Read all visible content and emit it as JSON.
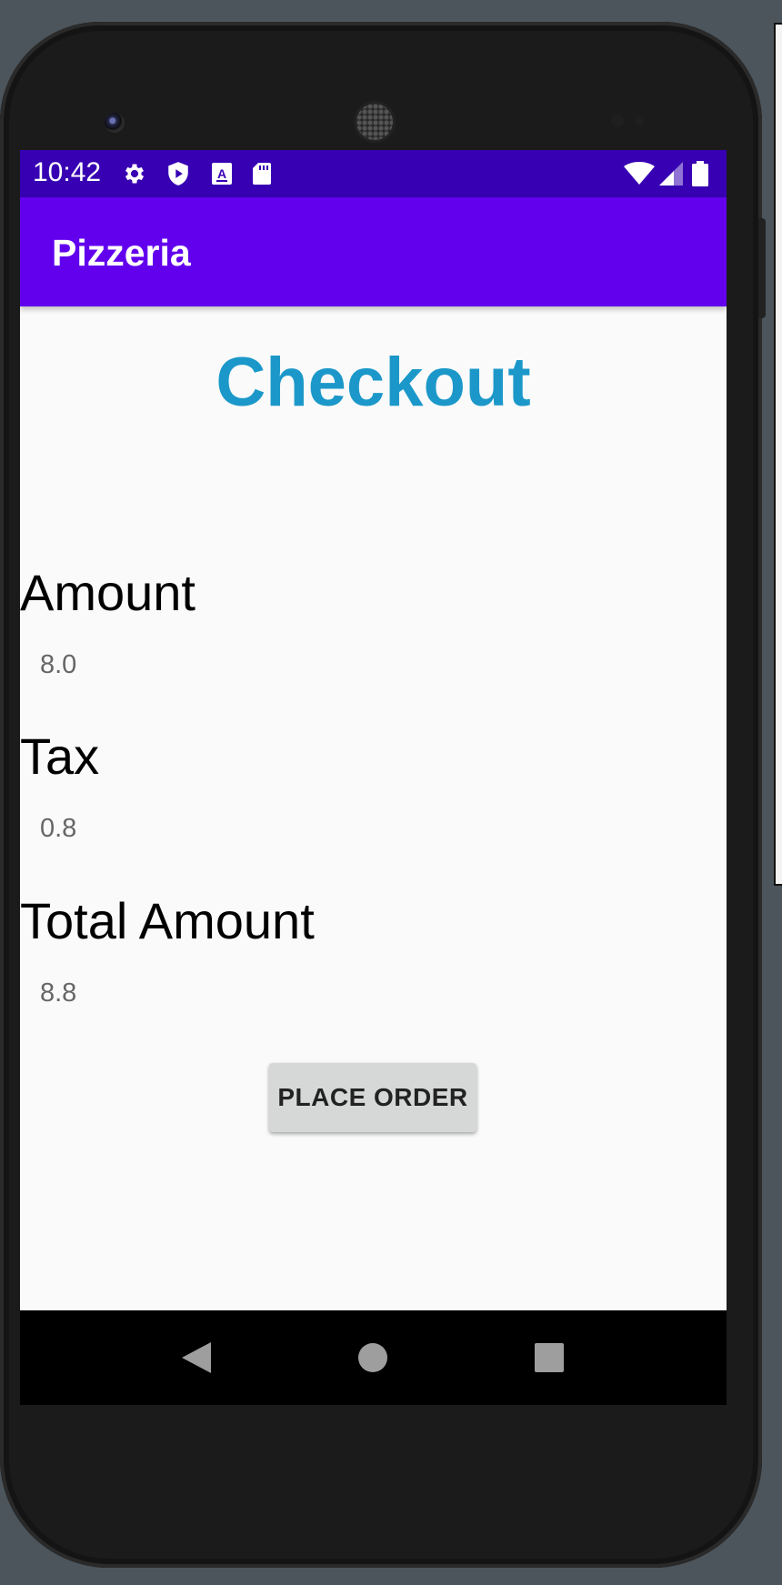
{
  "status_bar": {
    "time": "10:42",
    "left_icons": [
      "gear-icon",
      "shield-play-icon",
      "a-text-icon",
      "sd-card-icon"
    ],
    "right_icons": [
      "wifi-icon",
      "cellular-signal-icon",
      "battery-icon"
    ],
    "color": "#3700b3"
  },
  "app_bar": {
    "title": "Pizzeria",
    "color": "#6200ee"
  },
  "checkout": {
    "title": "Checkout",
    "title_color": "#1b98c9",
    "amount_label": "Amount",
    "amount_value": "8.0",
    "tax_label": "Tax",
    "tax_value": "0.8",
    "total_label": "Total Amount",
    "total_value": "8.8",
    "place_order_label": "PLACE ORDER"
  },
  "nav_bar": {
    "icons": [
      "back-icon",
      "home-icon",
      "recents-icon"
    ]
  }
}
